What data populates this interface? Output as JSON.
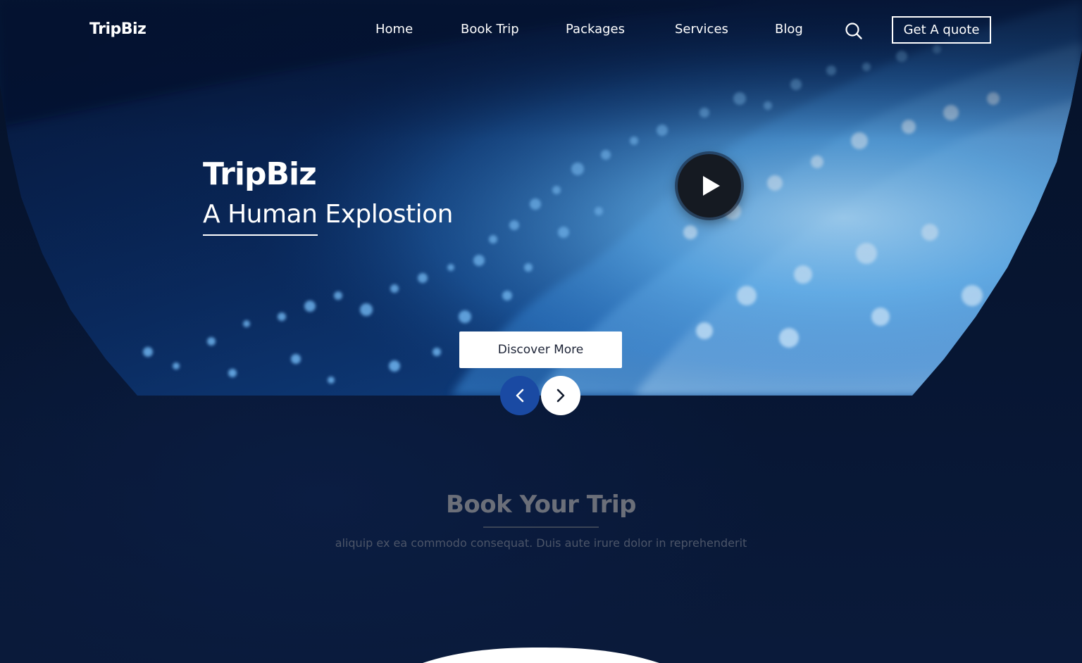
{
  "brand": {
    "logo_text": "TripBiz"
  },
  "nav": {
    "items": [
      {
        "label": "Home"
      },
      {
        "label": "Book Trip"
      },
      {
        "label": "Packages"
      },
      {
        "label": "Services"
      },
      {
        "label": "Blog"
      }
    ],
    "search_icon": "search-icon",
    "quote_button_label": "Get A quote"
  },
  "hero": {
    "title": "TripBiz",
    "subtitle": "A Human Explostion",
    "discover_label": "Discover More",
    "play_icon": "play-icon",
    "prev_icon": "chevron-left-icon",
    "next_icon": "chevron-right-icon"
  },
  "book_section": {
    "title": "Book Your Trip",
    "description": "aliquip ex ea commodo consequat. Duis aute irure dolor in reprehenderit"
  },
  "colors": {
    "page_background": "#071633",
    "accent_blue": "#1a4aa3",
    "water_light": "#7fc4ff",
    "white": "#ffffff"
  }
}
